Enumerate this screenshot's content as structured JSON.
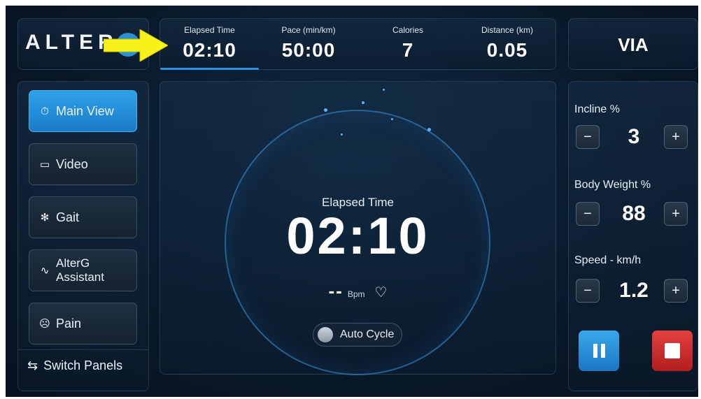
{
  "header": {
    "logo": "ALTERG",
    "stats": [
      {
        "label": "Elapsed Time",
        "value": "02:10"
      },
      {
        "label": "Pace (min/km)",
        "value": "50:00"
      },
      {
        "label": "Calories",
        "value": "7"
      },
      {
        "label": "Distance (km)",
        "value": "0.05"
      }
    ],
    "mode": "VIA"
  },
  "sidebar": {
    "items": [
      {
        "label": "Main View",
        "icon": "timer-icon",
        "active": true
      },
      {
        "label": "Video",
        "icon": "video-camera-icon"
      },
      {
        "label": "Gait",
        "icon": "walking-figure-icon"
      },
      {
        "label": "AlterG Assistant",
        "line1": "AlterG",
        "line2": "Assistant",
        "icon": "pulse-icon"
      },
      {
        "label": "Pain",
        "icon": "sad-face-icon"
      }
    ],
    "switch_panels": "Switch Panels"
  },
  "main": {
    "elapsed_label": "Elapsed Time",
    "elapsed_value": "02:10",
    "heart_rate": "--",
    "heart_rate_unit": "Bpm",
    "auto_cycle": "Auto Cycle"
  },
  "controls": {
    "incline": {
      "label": "Incline %",
      "value": "3"
    },
    "body_weight": {
      "label": "Body Weight %",
      "value": "88"
    },
    "speed": {
      "label": "Speed - km/h",
      "value": "1.2"
    },
    "minus": "−",
    "plus": "+"
  },
  "colors": {
    "accent": "#2d93e0",
    "stop": "#d73232",
    "arrow": "#f6f21a",
    "background": "#0a1a2c"
  }
}
